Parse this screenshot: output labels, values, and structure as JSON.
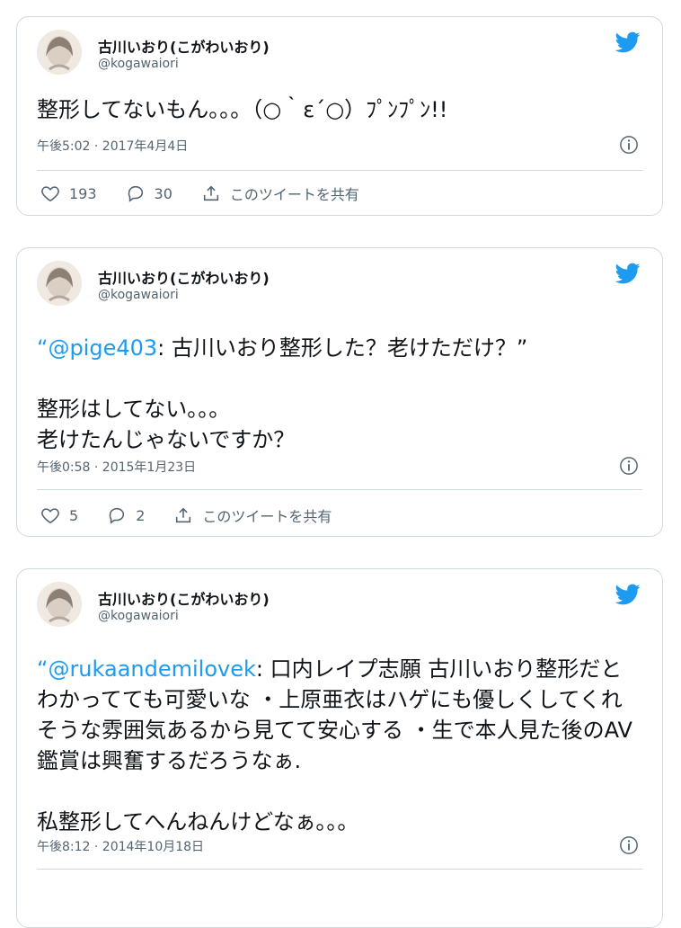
{
  "tweets": [
    {
      "name": "古川いおり(こがわいおり)",
      "handle": "@kogawaiori",
      "mention": "",
      "text": "整形してないもん。。。（○｀ε´○）ﾌﾟﾝﾌﾟﾝ!!",
      "timestamp": "午後5:02 · 2017年4月4日",
      "likes": "193",
      "replies": "30",
      "share_label": "このツイートを共有"
    },
    {
      "name": "古川いおり(こがわいおり)",
      "handle": "@kogawaiori",
      "quote_open": "“",
      "mention": "@pige403",
      "text": ": 古川いおり整形した？老けただけ？”\n\n整形はしてない。。。\n老けたんじゃないですか？",
      "timestamp": "午後0:58 · 2015年1月23日",
      "likes": "5",
      "replies": "2",
      "share_label": "このツイートを共有"
    },
    {
      "name": "古川いおり(こがわいおり)",
      "handle": "@kogawaiori",
      "quote_open": "“",
      "mention": "@rukaandemilovek",
      "text": ": 口内レイプ志願 古川いおり整形だとわかってても可愛いな ・上原亜衣はハゲにも優しくしてくれそうな雰囲気あるから見てて安心する ・生で本人見た後のAV鑑賞は興奮するだろうなぁ.\n\n私整形してへんねんけどなぁ。。。",
      "timestamp": "午後8:12 · 2014年10月18日"
    }
  ],
  "icons": {
    "brand": "twitter-bird-icon",
    "info": "info-icon",
    "like": "heart-icon",
    "reply": "reply-icon",
    "share": "share-icon"
  },
  "colors": {
    "accent": "#1d9bf0",
    "muted": "#536471",
    "border": "#cfd9de"
  }
}
